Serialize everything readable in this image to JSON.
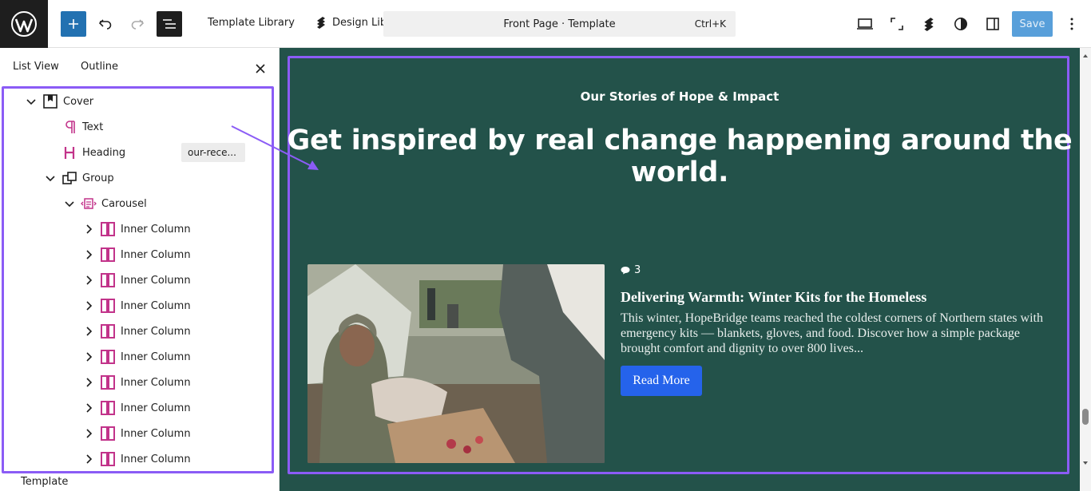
{
  "toolbar": {
    "template_library": "Template Library",
    "design_library": "Design Library",
    "document_title": "Front Page · Template",
    "shortcut": "Ctrl+K",
    "save_label": "Save"
  },
  "sidebar": {
    "tabs": [
      "List View",
      "Outline"
    ],
    "footer": "Template",
    "tree": [
      {
        "label": "Cover",
        "icon": "cover-icon",
        "chevron": "down"
      },
      {
        "label": "Text",
        "icon": "paragraph-icon"
      },
      {
        "label": "Heading",
        "icon": "heading-icon",
        "anchor": "our-rece..."
      },
      {
        "label": "Group",
        "icon": "group-icon",
        "chevron": "down"
      },
      {
        "label": "Carousel",
        "icon": "carousel-icon",
        "chevron": "down"
      },
      {
        "label": "Inner Column",
        "icon": "column-icon",
        "chevron": "right"
      },
      {
        "label": "Inner Column",
        "icon": "column-icon",
        "chevron": "right"
      },
      {
        "label": "Inner Column",
        "icon": "column-icon",
        "chevron": "right"
      },
      {
        "label": "Inner Column",
        "icon": "column-icon",
        "chevron": "right"
      },
      {
        "label": "Inner Column",
        "icon": "column-icon",
        "chevron": "right"
      },
      {
        "label": "Inner Column",
        "icon": "column-icon",
        "chevron": "right"
      },
      {
        "label": "Inner Column",
        "icon": "column-icon",
        "chevron": "right"
      },
      {
        "label": "Inner Column",
        "icon": "column-icon",
        "chevron": "right"
      },
      {
        "label": "Inner Column",
        "icon": "column-icon",
        "chevron": "right"
      },
      {
        "label": "Inner Column",
        "icon": "column-icon",
        "chevron": "right"
      }
    ]
  },
  "canvas": {
    "eyebrow": "Our Stories of Hope & Impact",
    "heading": "Get inspired by real change happening around the world.",
    "post": {
      "comments": "3",
      "title": "Delivering Warmth: Winter Kits for the Homeless",
      "excerpt": "This winter, HopeBridge teams reached the coldest corners of Northern states with emergency kits — blankets, gloves, and food. Discover how a simple package brought comfort and dignity to over 800 lives...",
      "button": "Read More"
    }
  },
  "colors": {
    "accent": "#8b5cf6",
    "canvas_bg": "#23524a",
    "wp_blue": "#2271b1",
    "read_more": "#2563eb",
    "block_icon_pink": "#c2338a"
  }
}
